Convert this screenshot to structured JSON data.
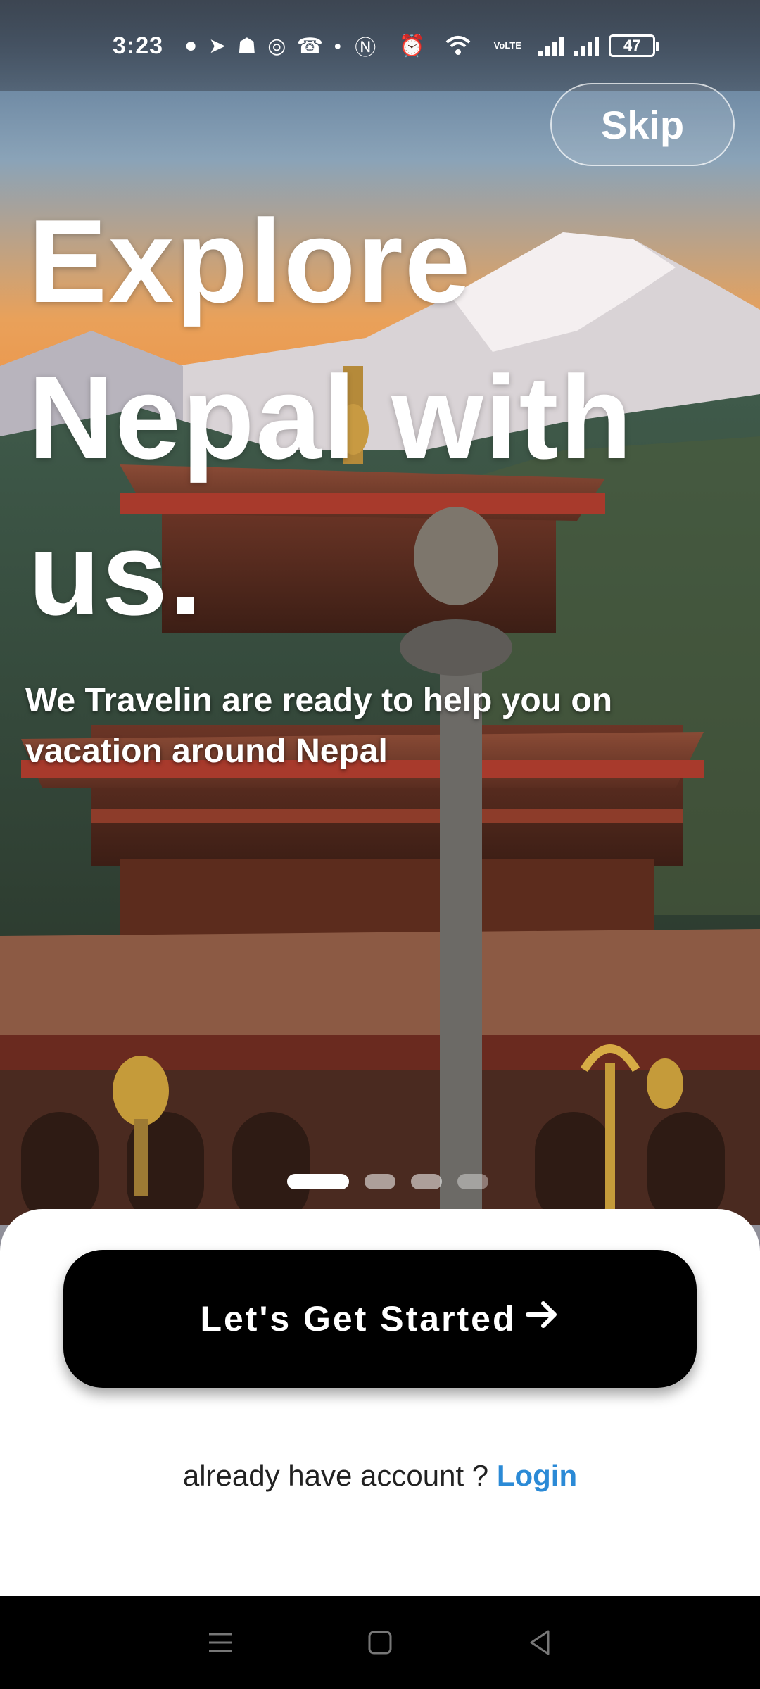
{
  "status_bar": {
    "time": "3:23",
    "icons": [
      "message-icon",
      "telegram-icon",
      "snapchat-icon",
      "whatsapp-icon",
      "missed-call-icon",
      "dot-icon",
      "nfc-icon",
      "alarm-icon",
      "wifi-icon",
      "volte-icon",
      "signal-icon",
      "signal-icon"
    ],
    "volte_text": "VoLTE",
    "battery": "47"
  },
  "onboarding": {
    "skip_label": "Skip",
    "headline_lines": [
      "Explore",
      "Nepal with",
      "us."
    ],
    "subtitle_lines": [
      "We Travelin are ready to help you on",
      "vacation around Nepal"
    ],
    "page_indicator": {
      "total": 4,
      "active": 1
    }
  },
  "sheet": {
    "cta_label": "Let's Get Started",
    "cta_icon": "arrow-right-icon",
    "prompt_text": "already have account ? ",
    "login_label": "Login"
  },
  "nav_bar": {
    "buttons": [
      "menu-icon",
      "home-icon",
      "back-icon"
    ]
  },
  "colors": {
    "cta_bg": "#000000",
    "login_link": "#2b8ad6",
    "sheet_bg": "#ffffff"
  }
}
